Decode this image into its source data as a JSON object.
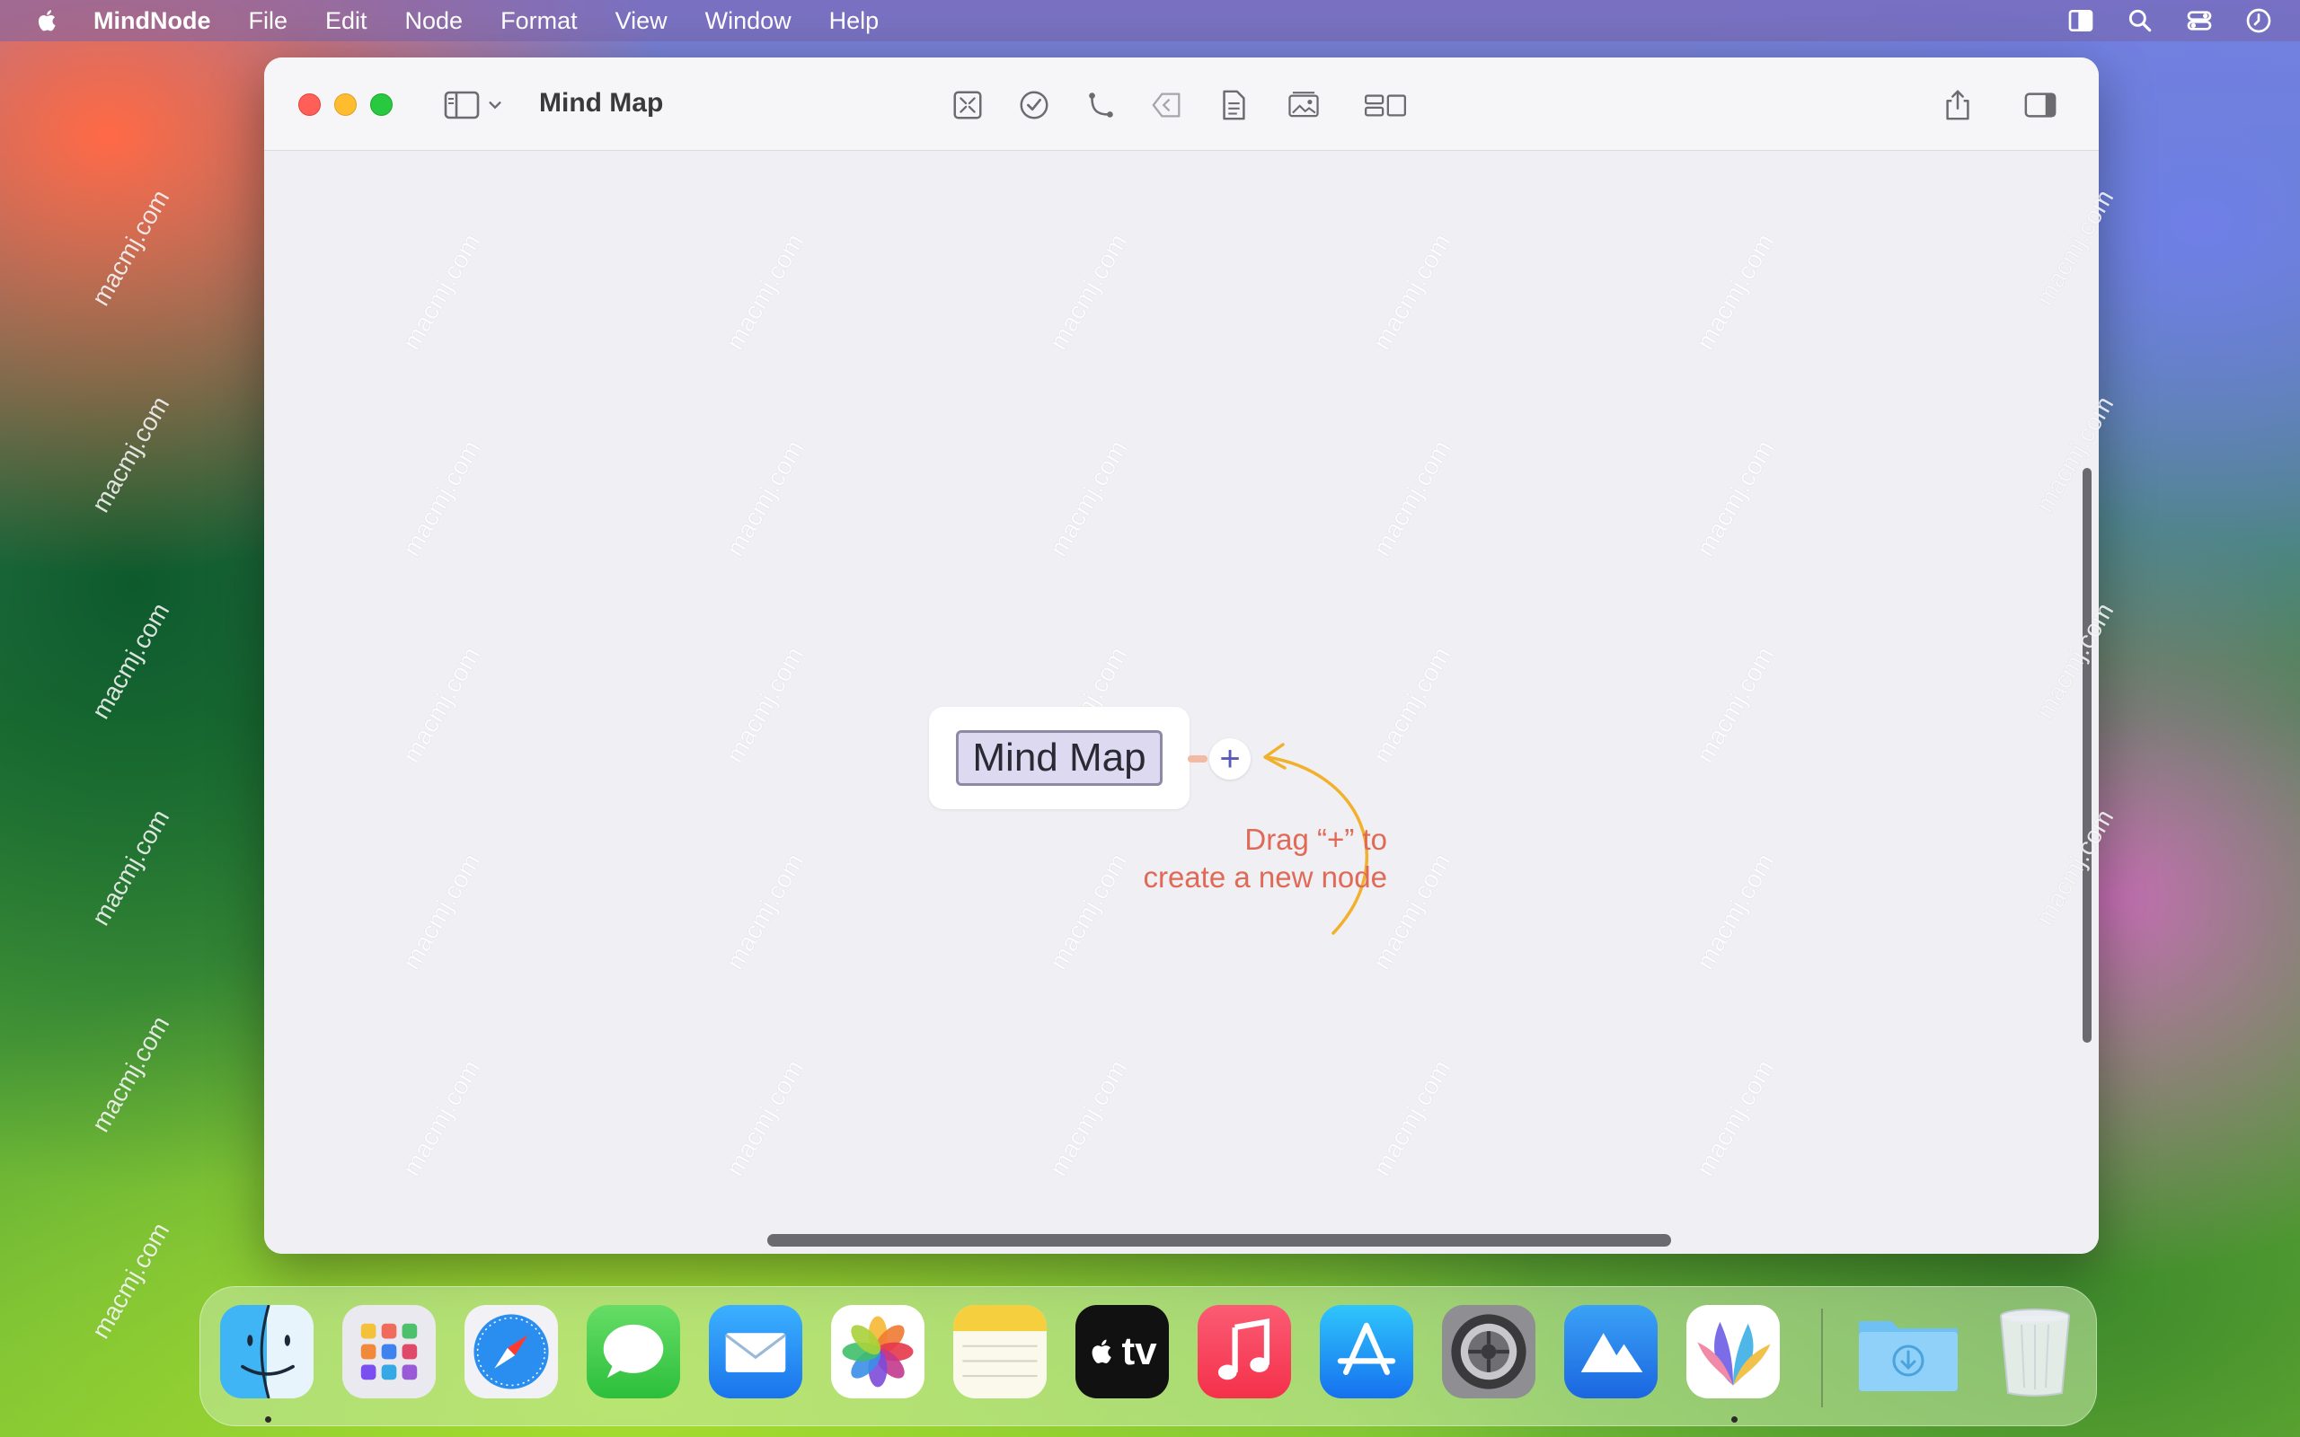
{
  "menubar": {
    "app_name": "MindNode",
    "items": [
      "File",
      "Edit",
      "Node",
      "Format",
      "View",
      "Window",
      "Help"
    ]
  },
  "window": {
    "title": "Mind Map"
  },
  "toolbar": {
    "tools": [
      "focus-icon",
      "task-icon",
      "connect-icon",
      "back-icon",
      "note-icon",
      "image-icon",
      "layout-icon"
    ]
  },
  "canvas": {
    "node_text": "Mind Map",
    "add_handle": "+",
    "hint_line1": "Drag “+” to",
    "hint_line2": "create a new node",
    "hint_color": "#e06a55",
    "arrow_color": "#f2b12c"
  },
  "dock": {
    "apps": [
      "Finder",
      "Launchpad",
      "Safari",
      "Messages",
      "Mail",
      "Photos",
      "Notes",
      "TV",
      "Music",
      "App Store",
      "System Settings",
      "Instruments",
      "MindNode",
      "Downloads",
      "Trash"
    ],
    "tv_label": "tv"
  },
  "watermark": "macmj.com"
}
